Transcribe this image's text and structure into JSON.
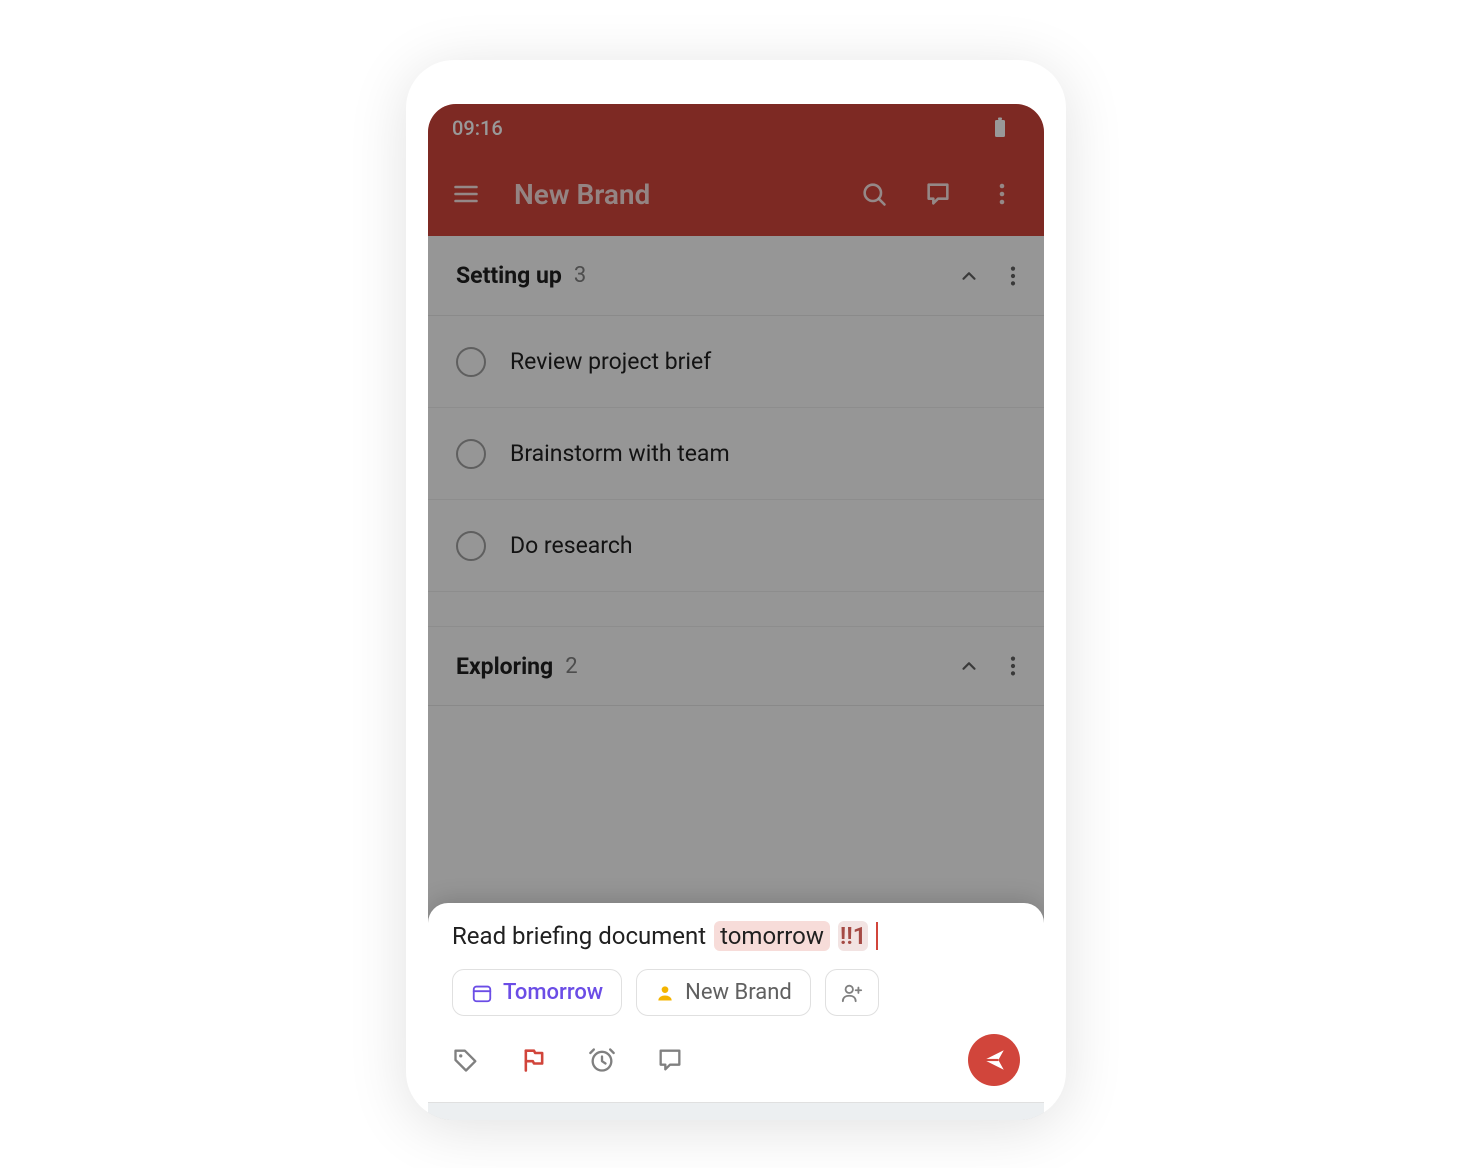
{
  "status_bar": {
    "time": "09:16"
  },
  "header": {
    "title": "New Brand"
  },
  "sections": [
    {
      "title": "Setting up",
      "count": "3",
      "tasks": [
        "Review project brief",
        "Brainstorm with team",
        "Do research"
      ]
    },
    {
      "title": "Exploring",
      "count": "2",
      "tasks": []
    }
  ],
  "quick_add": {
    "text_plain": "Read briefing document",
    "token_date": "tomorrow",
    "token_priority": "!!1",
    "chip_date": "Tomorrow",
    "chip_project": "New Brand"
  },
  "colors": {
    "brand_red": "#d1453b",
    "chip_purple": "#6b4de6",
    "chip_yellow": "#f4b400"
  }
}
